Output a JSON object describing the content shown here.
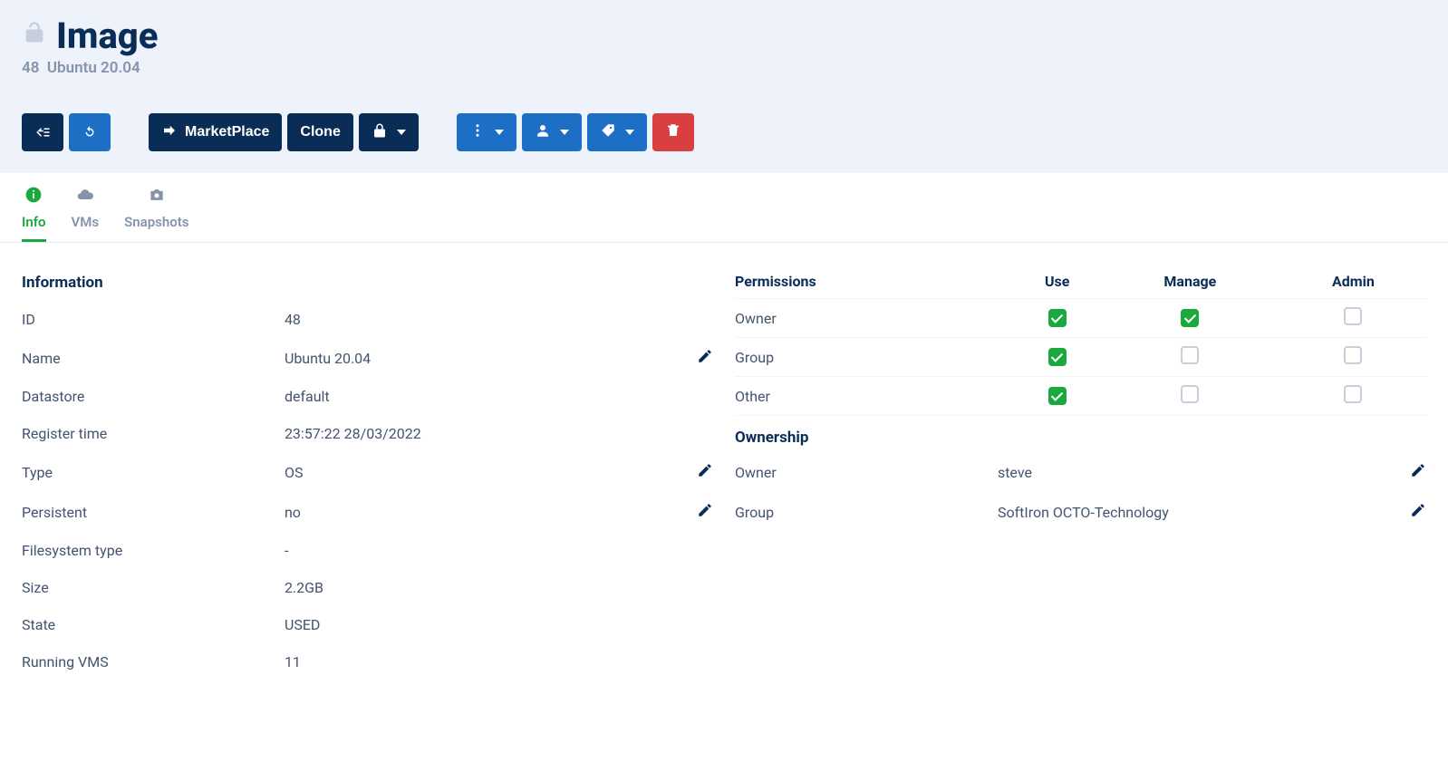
{
  "header": {
    "title": "Image",
    "subtitle_id": "48",
    "subtitle_name": "Ubuntu 20.04"
  },
  "toolbar": {
    "marketplace": "MarketPlace",
    "clone": "Clone"
  },
  "tabs": {
    "info": "Info",
    "vms": "VMs",
    "snapshots": "Snapshots"
  },
  "info": {
    "section_title": "Information",
    "rows": {
      "id": {
        "label": "ID",
        "value": "48"
      },
      "name": {
        "label": "Name",
        "value": "Ubuntu 20.04"
      },
      "datastore": {
        "label": "Datastore",
        "value": "default"
      },
      "register_time": {
        "label": "Register time",
        "value": "23:57:22 28/03/2022"
      },
      "type": {
        "label": "Type",
        "value": "OS"
      },
      "persistent": {
        "label": "Persistent",
        "value": "no"
      },
      "fstype": {
        "label": "Filesystem type",
        "value": "-"
      },
      "size": {
        "label": "Size",
        "value": "2.2GB"
      },
      "state": {
        "label": "State",
        "value": "USED"
      },
      "running_vms": {
        "label": "Running VMS",
        "value": "11"
      }
    }
  },
  "permissions": {
    "section_title": "Permissions",
    "headers": {
      "use": "Use",
      "manage": "Manage",
      "admin": "Admin"
    },
    "rows": {
      "owner": {
        "label": "Owner",
        "use": true,
        "manage": true,
        "admin": false
      },
      "group": {
        "label": "Group",
        "use": true,
        "manage": false,
        "admin": false
      },
      "other": {
        "label": "Other",
        "use": true,
        "manage": false,
        "admin": false
      }
    }
  },
  "ownership": {
    "section_title": "Ownership",
    "owner": {
      "label": "Owner",
      "value": "steve"
    },
    "group": {
      "label": "Group",
      "value": "SoftIron OCTO-Technology"
    }
  }
}
